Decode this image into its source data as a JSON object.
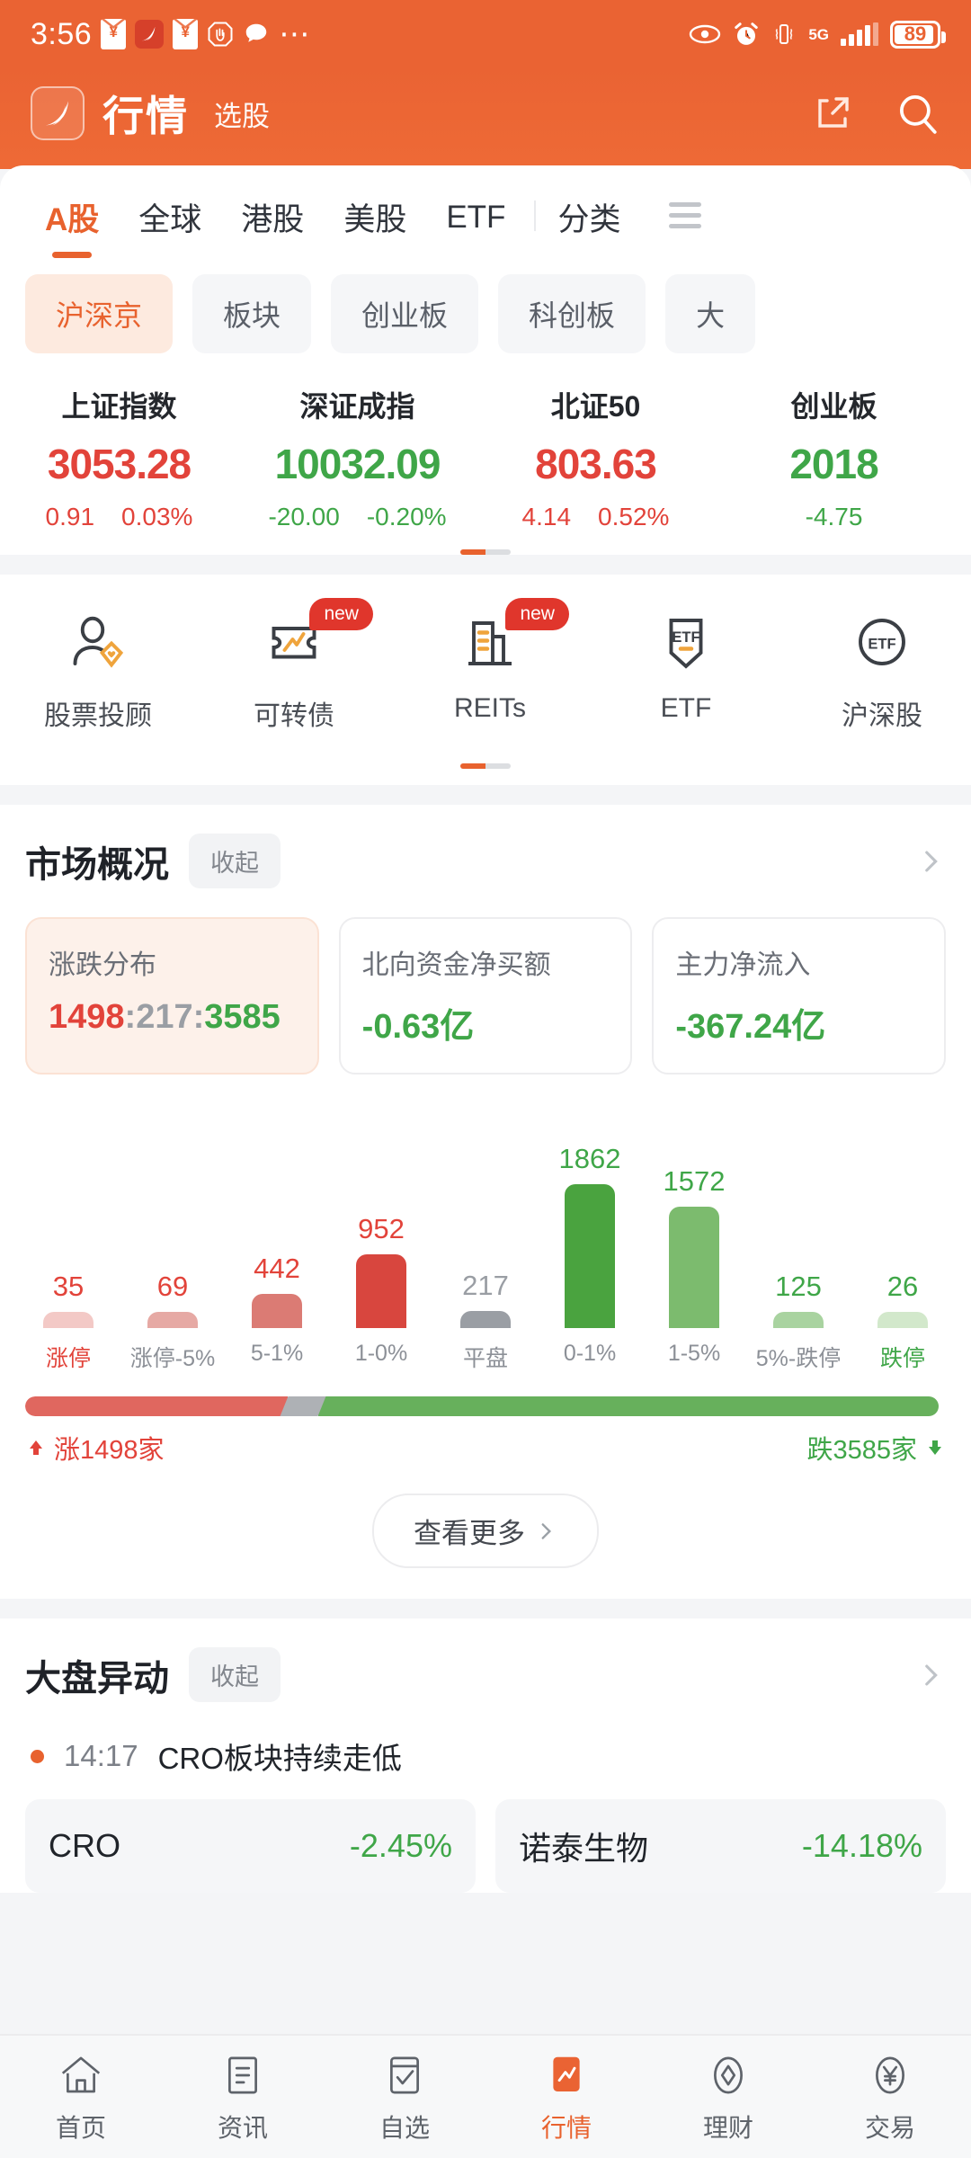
{
  "statusbar": {
    "time": "3:56",
    "icons": [
      "red-packet-icon",
      "app-logo-icon",
      "red-packet-icon",
      "stop-hand-icon",
      "chat-bubble-icon",
      "more-dots-icon"
    ],
    "right_icons": [
      "eye-icon",
      "alarm-clock-icon",
      "vibrate-icon"
    ],
    "network": "5G",
    "battery_percent": "89"
  },
  "header": {
    "logo": "app-logo-icon",
    "title": "行情",
    "subtitle": "选股",
    "share_icon": "share-icon",
    "search_icon": "search-icon"
  },
  "tabs": [
    {
      "label": "A股",
      "active": true
    },
    {
      "label": "全球",
      "active": false
    },
    {
      "label": "港股",
      "active": false
    },
    {
      "label": "美股",
      "active": false
    },
    {
      "label": "ETF",
      "active": false
    },
    {
      "label": "分类",
      "active": false
    }
  ],
  "tabs_menu_icon": "hamburger-menu-icon",
  "chips": [
    {
      "label": "沪深京",
      "active": true
    },
    {
      "label": "板块",
      "active": false
    },
    {
      "label": "创业板",
      "active": false
    },
    {
      "label": "科创板",
      "active": false
    },
    {
      "label": "大",
      "active": false
    }
  ],
  "indices": [
    {
      "name": "上证指数",
      "value": "3053.28",
      "change": "0.91",
      "percent": "0.03%",
      "dir": "up"
    },
    {
      "name": "深证成指",
      "value": "10032.09",
      "change": "-20.00",
      "percent": "-0.20%",
      "dir": "down"
    },
    {
      "name": "北证50",
      "value": "803.63",
      "change": "4.14",
      "percent": "0.52%",
      "dir": "up"
    },
    {
      "name": "创业板",
      "value": "2018",
      "change": "-4.75",
      "percent": "",
      "dir": "down"
    }
  ],
  "quick_links": [
    {
      "label": "股票投顾",
      "icon": "advisor-icon",
      "badge": ""
    },
    {
      "label": "可转债",
      "icon": "convertible-bond-icon",
      "badge": "new"
    },
    {
      "label": "REITs",
      "icon": "reits-building-icon",
      "badge": "new"
    },
    {
      "label": "ETF",
      "icon": "etf-shield-icon",
      "badge": ""
    },
    {
      "label": "沪深股",
      "icon": "etf-circle-icon",
      "badge": ""
    }
  ],
  "market_overview": {
    "title": "市场概况",
    "collapse_label": "收起",
    "chevron_icon": "chevron-right-icon",
    "metrics": [
      {
        "label": "涨跌分布",
        "value_up": "1498",
        "value_flat": "217",
        "value_down": "3585",
        "highlight": true
      },
      {
        "label": "北向资金净买额",
        "value": "-0.63亿",
        "dir": "down"
      },
      {
        "label": "主力净流入",
        "value": "-367.24亿",
        "dir": "down"
      }
    ],
    "ratio": {
      "up_label": "涨1498家",
      "down_label": "跌3585家",
      "up_arrow": "arrow-up-icon",
      "down_arrow": "arrow-down-icon",
      "up_pct": 28.5,
      "flat_pct": 4.1,
      "down_pct": 67.4
    },
    "more_label": "查看更多",
    "more_chevron": "chevron-right-icon"
  },
  "chart_data": {
    "type": "bar",
    "title": "涨跌分布",
    "categories": [
      "涨停",
      "涨停-5%",
      "5-1%",
      "1-0%",
      "平盘",
      "0-1%",
      "1-5%",
      "5%-跌停",
      "跌停"
    ],
    "values": [
      35,
      69,
      442,
      952,
      217,
      1862,
      1572,
      125,
      26
    ],
    "colors": [
      "#f3c9c6",
      "#e6a9a4",
      "#db7b74",
      "#d8463e",
      "#9a9ea4",
      "#4aa33f",
      "#7cbb6e",
      "#a9d3a0",
      "#d2e8cb"
    ],
    "label_colors": [
      "#e2433a",
      "#8c9097",
      "#8c9097",
      "#8c9097",
      "#8c9097",
      "#8c9097",
      "#8c9097",
      "#8c9097",
      "#3fa648"
    ],
    "value_colors": [
      "#e2433a",
      "#e2433a",
      "#e2433a",
      "#e2433a",
      "#9a9ea4",
      "#3fa648",
      "#3fa648",
      "#3fa648",
      "#3fa648"
    ],
    "xlabel": "",
    "ylabel": "",
    "ylim": [
      0,
      1862
    ],
    "grid": false,
    "legend": "none"
  },
  "market_moves": {
    "title": "大盘异动",
    "collapse_label": "收起",
    "chevron_icon": "chevron-right-icon",
    "alert": {
      "time": "14:17",
      "text": "CRO板块持续走低",
      "dot": "alert-dot-icon"
    },
    "movers": [
      {
        "name": "CRO",
        "change": "-2.45%"
      },
      {
        "name": "诺泰生物",
        "change": "-14.18%"
      }
    ]
  },
  "bottom_nav": [
    {
      "label": "首页",
      "icon": "home-icon",
      "active": false
    },
    {
      "label": "资讯",
      "icon": "news-icon",
      "active": false
    },
    {
      "label": "自选",
      "icon": "watchlist-icon",
      "active": false
    },
    {
      "label": "行情",
      "icon": "market-chart-icon",
      "active": true
    },
    {
      "label": "理财",
      "icon": "wealth-diamond-icon",
      "active": false
    },
    {
      "label": "交易",
      "icon": "trade-yuan-icon",
      "active": false
    }
  ],
  "colors": {
    "brand": "#ea6333",
    "accent": "#e8622e",
    "up": "#e2433a",
    "down": "#3fa648",
    "flat": "#9a9ea4"
  }
}
